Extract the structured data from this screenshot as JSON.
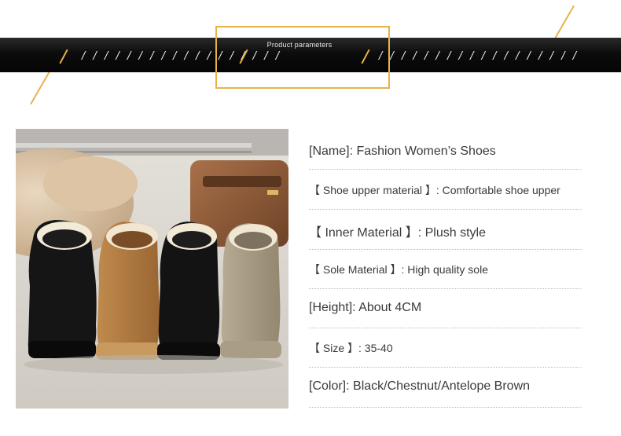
{
  "header": {
    "title": "Product parameters",
    "slashes_left": "/ / / / / / / / / / / / / / / / / /",
    "slashes_right": "/ / / / / / / / / / / / / / / / / /",
    "accent_color": "#e8b24a"
  },
  "photo": {
    "icon": "product-photo-boots"
  },
  "specs": [
    {
      "text": "[Name]: Fashion Women’s Shoes"
    },
    {
      "text": "【 Shoe upper material 】: Comfortable shoe upper"
    },
    {
      "text": "【 Inner Material 】: Plush style"
    },
    {
      "text": "【 Sole Material 】: High quality sole"
    },
    {
      "text": "[Height]: About 4CM"
    },
    {
      "text": "【 Size 】: 35-40"
    },
    {
      "text": "[Color]: Black/Chestnut/Antelope Brown"
    }
  ]
}
